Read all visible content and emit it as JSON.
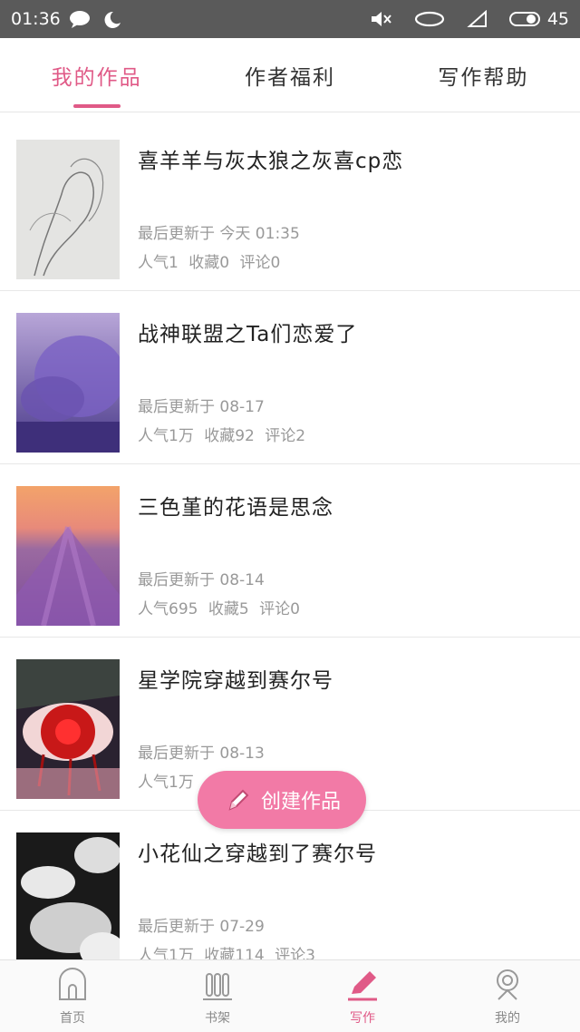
{
  "status_bar": {
    "time": "01:36",
    "battery": "45"
  },
  "tabs": [
    {
      "label": "我的作品",
      "active": true
    },
    {
      "label": "作者福利",
      "active": false
    },
    {
      "label": "写作帮助",
      "active": false
    }
  ],
  "works": [
    {
      "title": "喜羊羊与灰太狼之灰喜cp恋",
      "updated": "最后更新于 今天 01:35",
      "popularity": "人气1",
      "favorites": "收藏0",
      "comments": "评论0"
    },
    {
      "title": "战神联盟之Ta们恋爱了",
      "updated": "最后更新于 08-17",
      "popularity": "人气1万",
      "favorites": "收藏92",
      "comments": "评论2"
    },
    {
      "title": "三色堇的花语是思念",
      "updated": "最后更新于 08-14",
      "popularity": "人气695",
      "favorites": "收藏5",
      "comments": "评论0"
    },
    {
      "title": "星学院穿越到赛尔号",
      "updated": "最后更新于 08-13",
      "popularity": "人气1万",
      "favorites": "",
      "comments": ""
    },
    {
      "title": "小花仙之穿越到了赛尔号",
      "updated": "最后更新于 07-29",
      "popularity": "人气1万",
      "favorites": "收藏114",
      "comments": "评论3"
    }
  ],
  "fab": {
    "label": "创建作品"
  },
  "bottom_nav": [
    {
      "label": "首页",
      "icon": "home-icon",
      "active": false
    },
    {
      "label": "书架",
      "icon": "bookshelf-icon",
      "active": false
    },
    {
      "label": "写作",
      "icon": "pencil-icon",
      "active": true
    },
    {
      "label": "我的",
      "icon": "profile-icon",
      "active": false
    }
  ],
  "colors": {
    "accent": "#e05a87",
    "fab": "#f27aa6",
    "status_bar": "#5a5a5a"
  }
}
